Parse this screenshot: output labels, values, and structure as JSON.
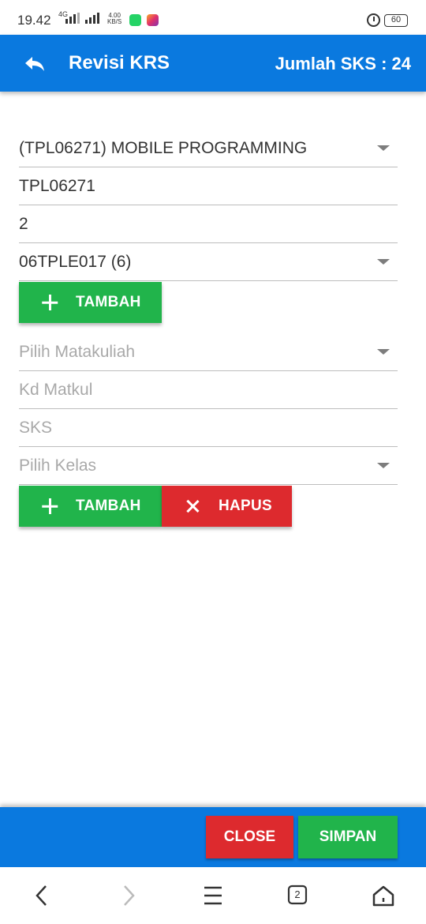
{
  "status_bar": {
    "time": "19.42",
    "network": "4G",
    "speed_value": "4.00",
    "speed_unit": "KB/S",
    "battery": "60",
    "icons": [
      "signal-icon",
      "whatsapp-icon",
      "instagram-icon",
      "alarm-icon",
      "battery-icon"
    ]
  },
  "appbar": {
    "title": "Revisi KRS",
    "sks_label": "Jumlah SKS : 24",
    "color": "#0a79df"
  },
  "entry1": {
    "course_select": "(TPL06271) MOBILE PROGRAMMING",
    "course_code": "TPL06271",
    "sks": "2",
    "class_select": "06TPLE017 (6)",
    "add_label": "TAMBAH"
  },
  "entry2": {
    "course_placeholder": "Pilih Matakuliah",
    "code_placeholder": "Kd Matkul",
    "sks_placeholder": "SKS",
    "class_placeholder": "Pilih Kelas",
    "add_label": "TAMBAH",
    "delete_label": "HAPUS"
  },
  "dialog_actions": {
    "close_label": "CLOSE",
    "save_label": "SIMPAN"
  },
  "navbar": {
    "tab_count": "2"
  },
  "colors": {
    "primary": "#0a79df",
    "success": "#21b44b",
    "danger": "#dd2a2e"
  }
}
